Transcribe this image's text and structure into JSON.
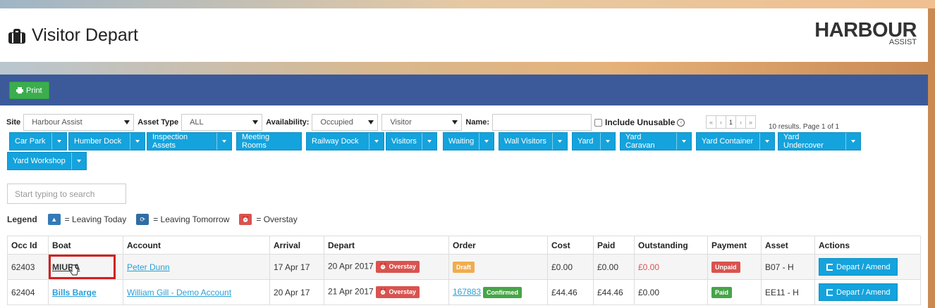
{
  "header": {
    "title": "Visitor Depart",
    "logo_main": "HARBOUR",
    "logo_sub": "ASSIST"
  },
  "toolbar": {
    "print_label": "Print"
  },
  "filters": {
    "site_label": "Site",
    "site_value": "Harbour Assist",
    "asset_type_label": "Asset Type",
    "asset_type_value": "ALL",
    "availability_label": "Availability:",
    "availability_value": "Occupied",
    "type_value": "Visitor",
    "name_label": "Name:",
    "name_value": "",
    "include_unusable_label": "Include Unusable",
    "include_unusable_checked": false
  },
  "pager": {
    "first": "«",
    "prev": "‹",
    "page": "1",
    "next": "›",
    "last": "»"
  },
  "results_text": "10 results. Page 1 of 1",
  "categories": [
    "Car Park",
    "Humber Dock",
    "Inspection Assets",
    "Meeting Rooms",
    "Railway Dock",
    "Visitors",
    "Waiting",
    "Wall Visitors",
    "Yard",
    "Yard Caravan",
    "Yard Container",
    "Yard Undercover",
    "Yard Workshop"
  ],
  "search": {
    "placeholder": "Start typing to search"
  },
  "legend": {
    "title": "Legend",
    "leaving_today": "= Leaving Today",
    "leaving_tomorrow": "= Leaving Tomorrow",
    "overstay": "= Overstay"
  },
  "table": {
    "headers": [
      "Occ Id",
      "Boat",
      "Account",
      "Arrival",
      "Depart",
      "Order",
      "Cost",
      "Paid",
      "Outstanding",
      "Payment",
      "Asset",
      "Actions"
    ],
    "rows": [
      {
        "occ_id": "62403",
        "boat": "MIURA",
        "account": "Peter Dunn",
        "arrival": "17 Apr 17",
        "depart": "20 Apr 2017",
        "depart_badge": "Overstay",
        "order_link": "",
        "order_badge": "Draft",
        "cost": "£0.00",
        "paid": "£0.00",
        "outstanding": "£0.00",
        "payment": "Unpaid",
        "asset": "B07 - H",
        "action": "Depart / Amend"
      },
      {
        "occ_id": "62404",
        "boat": "Bills Barge",
        "account": "William Gill - Demo Account",
        "arrival": "20 Apr 17",
        "depart": "21 Apr 2017",
        "depart_badge": "Overstay",
        "order_link": "167883",
        "order_badge": "Confirmed",
        "cost": "£44.46",
        "paid": "£44.46",
        "outstanding": "£0.00",
        "payment": "Paid",
        "asset": "EE11 - H",
        "action": "Depart / Amend"
      }
    ]
  },
  "colors": {
    "header_bar": "#3c5a99",
    "category_button": "#14a3dd",
    "print_button": "#3cad4f",
    "overstay_badge": "#d9534f",
    "draft_badge": "#f0ad4e",
    "paid_badge": "#47a447",
    "highlight_box": "#d21f1f"
  }
}
